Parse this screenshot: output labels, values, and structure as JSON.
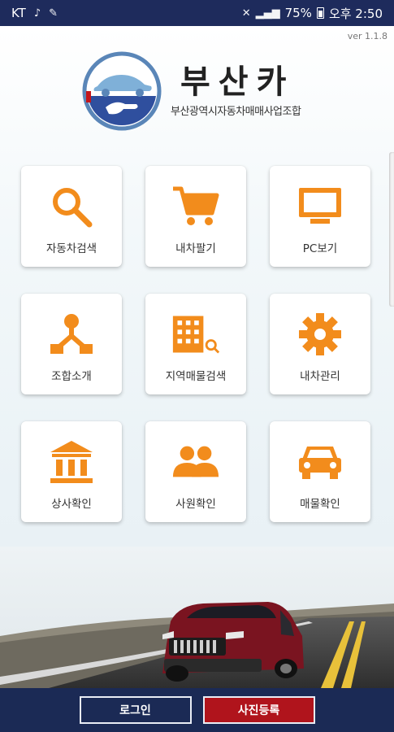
{
  "status_bar": {
    "carrier": "KT",
    "battery": "75%",
    "time": "오후 2:50"
  },
  "app": {
    "version": "ver 1.1.8",
    "logo_title": "부산카",
    "logo_subtitle": "부산광역시자동차매매사업조합"
  },
  "menu": [
    {
      "label": "자동차검색",
      "icon": "search-icon"
    },
    {
      "label": "내차팔기",
      "icon": "cart-icon"
    },
    {
      "label": "PC보기",
      "icon": "monitor-icon"
    },
    {
      "label": "조합소개",
      "icon": "network-icon"
    },
    {
      "label": "지역매물검색",
      "icon": "building-search-icon"
    },
    {
      "label": "내차관리",
      "icon": "gear-icon"
    },
    {
      "label": "상사확인",
      "icon": "bank-icon"
    },
    {
      "label": "사원확인",
      "icon": "people-icon"
    },
    {
      "label": "매물확인",
      "icon": "car-icon"
    }
  ],
  "bottom": {
    "login_label": "로그인",
    "photo_label": "사진등록"
  },
  "colors": {
    "accent": "#f28c1c",
    "navy": "#1b2a55",
    "red": "#b0141c"
  }
}
